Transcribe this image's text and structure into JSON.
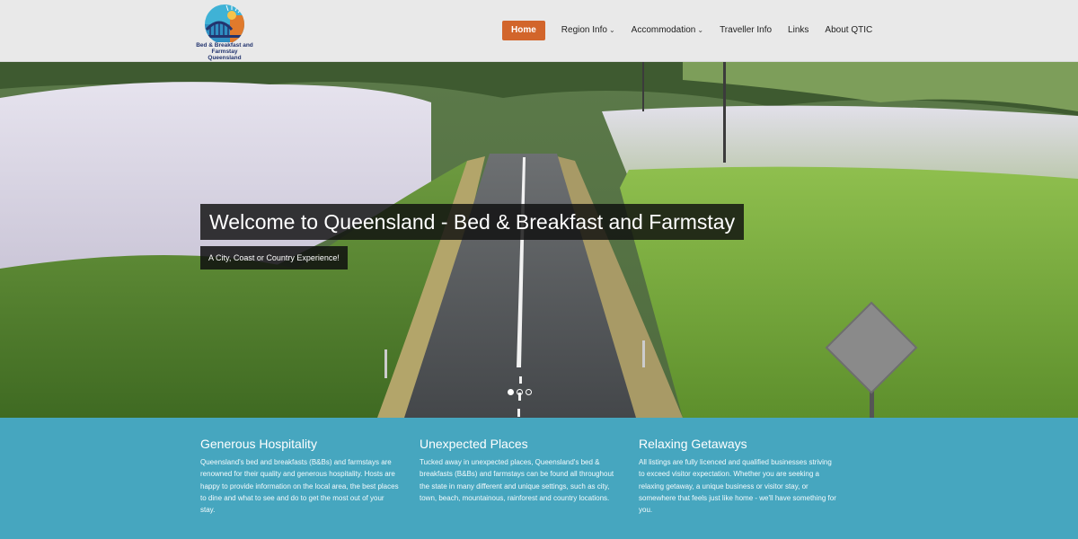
{
  "logo": {
    "line1": "Bed & Breakfast and",
    "line2": "Farmstay Queensland"
  },
  "nav": [
    {
      "label": "Home",
      "active": true,
      "dropdown": false
    },
    {
      "label": "Region Info",
      "active": false,
      "dropdown": true
    },
    {
      "label": "Accommodation",
      "active": false,
      "dropdown": true
    },
    {
      "label": "Traveller Info",
      "active": false,
      "dropdown": false
    },
    {
      "label": "Links",
      "active": false,
      "dropdown": false
    },
    {
      "label": "About QTIC",
      "active": false,
      "dropdown": false
    }
  ],
  "hero": {
    "title": "Welcome to Queensland - Bed & Breakfast and Farmstay",
    "subtitle": "A City, Coast or Country Experience!",
    "slides_total": 3,
    "slide_active": 1
  },
  "features": [
    {
      "title": "Generous Hospitality",
      "text": "Queensland's bed and breakfasts (B&Bs) and farmstays are renowned for their quality and generous hospitality. Hosts are happy to provide information on the local area, the best places to dine and what to see and do to get the most out of your stay."
    },
    {
      "title": "Unexpected Places",
      "text": "Tucked away in unexpected places, Queensland's bed & breakfasts (B&Bs) and farmstays can be found all throughout the state in many different and unique settings, such as city, town, beach, mountainous, rainforest and country locations."
    },
    {
      "title": "Relaxing Getaways",
      "text": "All listings are fully licenced and qualified businesses striving to exceed visitor expectation. Whether you are seeking a relaxing getaway, a unique business or visitor stay, or somewhere that feels just like home - we'll have something for you."
    }
  ],
  "colors": {
    "accent": "#d2652b",
    "band": "#46a6bf",
    "header": "#e9e9e9"
  }
}
